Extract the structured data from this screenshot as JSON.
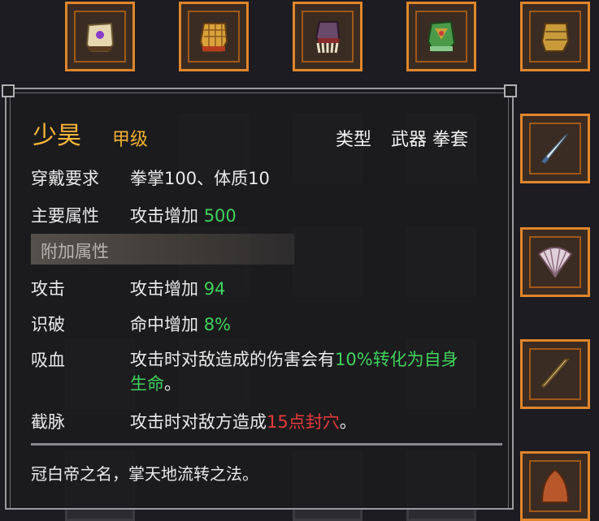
{
  "background_slots": {
    "top_row_icons": [
      "gauntlet-gem-icon",
      "gauntlet-mesh-icon",
      "gauntlet-claw-icon",
      "gauntlet-green-icon",
      "gauntlet-gold-icon"
    ],
    "right_column_icons": [
      "dagger-icon",
      "folding-fan-icon",
      "bone-blade-icon",
      "hood-icon"
    ]
  },
  "tooltip": {
    "item_name": "少昊",
    "grade": "甲级",
    "type_label": "类型",
    "type_value": "武器 拳套",
    "requirements": {
      "label": "穿戴要求",
      "value": "拳掌100、体质10"
    },
    "main_attribute": {
      "label": "主要属性",
      "text": "攻击增加 ",
      "amount": "500"
    },
    "extra_section_title": "附加属性",
    "extra": [
      {
        "label": "攻击",
        "text": "攻击增加 ",
        "amount": "94"
      },
      {
        "label": "识破",
        "text": "命中增加 ",
        "amount": "8%"
      }
    ],
    "lifesteal": {
      "label": "吸血",
      "text": "攻击时对敌造成的伤害会有",
      "highlight_line1": "10%转化为自身",
      "highlight_line2": "生命",
      "suffix": "。"
    },
    "meridian": {
      "label": "截脉",
      "text": "攻击时对敌方造成",
      "highlight": "15点封穴",
      "suffix": "。"
    },
    "description": "冠白帝之名，掌天地流转之法。"
  },
  "colors": {
    "title": "#ffb838",
    "highlight_green": "#3fd35c",
    "highlight_red": "#e83a3a",
    "slot_border_orange": "#e0862b"
  }
}
